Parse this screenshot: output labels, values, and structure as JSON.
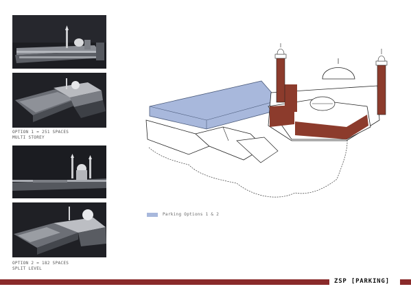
{
  "options": [
    {
      "line1": "OPTION 1 = 251 SPACES",
      "line2": "MULTI STOREY"
    },
    {
      "line1": "OPTION 2 = 182 SPACES",
      "line2": "SPLIT LEVEL"
    }
  ],
  "legend": {
    "label": "Parking Options 1 & 2",
    "color": "#a8b8dc"
  },
  "footer": {
    "title": "ZSP [PARKING]",
    "bar_color": "#8a2a2a"
  },
  "colors": {
    "brick": "#8c3b2c",
    "parking": "#a8b8dc",
    "render_bg": "#1e1f24"
  }
}
